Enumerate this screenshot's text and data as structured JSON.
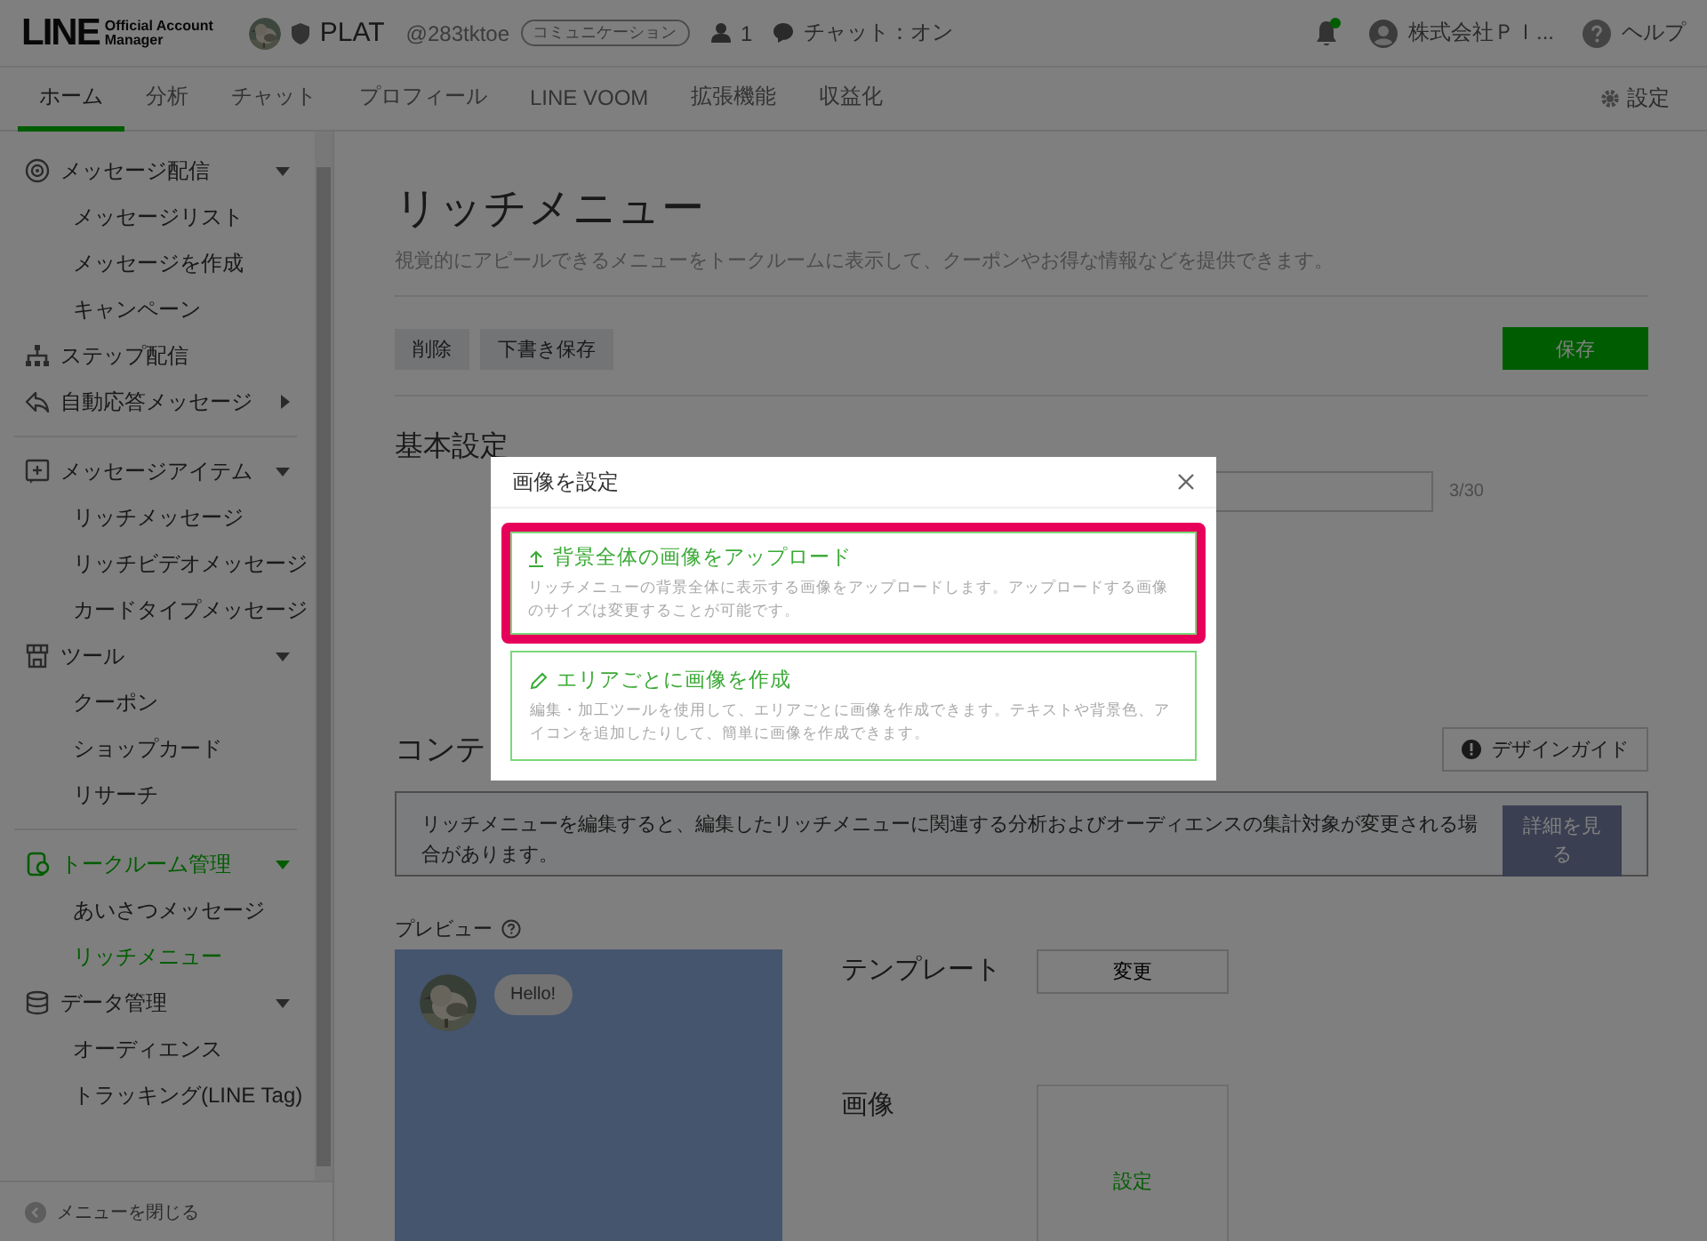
{
  "header": {
    "logo": {
      "word": "LINE",
      "tagline_1": "Official Account",
      "tagline_2": "Manager"
    },
    "account": {
      "name": "PLAT",
      "handle": "@283tktoe",
      "plan": "コミュニケーション",
      "members": "1",
      "chat": "チャット：オン"
    },
    "notifications": {
      "unread": true
    },
    "user": "株式会社ＰＩ...",
    "help": "ヘルプ"
  },
  "tabs": [
    {
      "label": "ホーム",
      "selected": true
    },
    {
      "label": "分析",
      "selected": false
    },
    {
      "label": "チャット",
      "selected": false
    },
    {
      "label": "プロフィール",
      "selected": false
    },
    {
      "label": "LINE VOOM",
      "selected": false
    },
    {
      "label": "拡張機能",
      "selected": false
    },
    {
      "label": "収益化",
      "selected": false
    }
  ],
  "settings": "設定",
  "sidebar": {
    "groups": [
      {
        "items": [
          {
            "label": "メッセージ配信",
            "selected": false,
            "expanded": true,
            "children": [
              {
                "label": "メッセージリスト",
                "selected": false
              },
              {
                "label": "メッセージを作成",
                "selected": false
              },
              {
                "label": "キャンペーン",
                "selected": false
              }
            ]
          },
          {
            "label": "ステップ配信",
            "selected": false
          },
          {
            "label": "自動応答メッセージ",
            "selected": false,
            "expanded": false
          }
        ]
      },
      {
        "items": [
          {
            "label": "メッセージアイテム",
            "selected": false,
            "expanded": true,
            "children": [
              {
                "label": "リッチメッセージ",
                "selected": false
              },
              {
                "label": "リッチビデオメッセージ",
                "selected": false
              },
              {
                "label": "カードタイプメッセージ",
                "selected": false
              }
            ]
          },
          {
            "label": "ツール",
            "selected": false,
            "expanded": true,
            "children": [
              {
                "label": "クーポン",
                "selected": false
              },
              {
                "label": "ショップカード",
                "selected": false
              },
              {
                "label": "リサーチ",
                "selected": false
              }
            ]
          }
        ]
      },
      {
        "items": [
          {
            "label": "トークルーム管理",
            "selected": true,
            "expanded": true,
            "children": [
              {
                "label": "あいさつメッセージ",
                "selected": false
              },
              {
                "label": "リッチメニュー",
                "selected": true
              }
            ]
          },
          {
            "label": "データ管理",
            "selected": false,
            "expanded": true,
            "children": [
              {
                "label": "オーディエンス",
                "selected": false
              },
              {
                "label": "トラッキング(LINE Tag)",
                "selected": false
              }
            ]
          }
        ]
      }
    ],
    "close": "メニューを閉じる"
  },
  "main": {
    "title": "リッチメニュー",
    "description": "視覚的にアピールできるメニューをトークルームに表示して、クーポンやお得な情報などを提供できます。",
    "actions": [
      {
        "label": "削除",
        "kind": "secondary"
      },
      {
        "label": "下書き保存",
        "kind": "secondary"
      },
      {
        "label": "保存",
        "kind": "primary"
      }
    ],
    "basic": {
      "heading": "基本設定",
      "counter": "3/30"
    },
    "content": {
      "heading": "コンテ",
      "guide": "デザインガイド",
      "notice": "リッチメニューを編集すると、編集したリッチメニューに関連する分析およびオーディエンスの集計対象が変更される場合があります。",
      "notice_button": "詳細を見る",
      "preview_label": "プレビュー",
      "bubble": "Hello!",
      "template_label": "テンプレート",
      "template_button": "変更",
      "image_label": "画像",
      "image_button": "設定"
    }
  },
  "dialog": {
    "title": "画像を設定",
    "options": [
      {
        "title": "背景全体の画像をアップロード",
        "description": "リッチメニューの背景全体に表示する画像をアップロードします。アップロードする画像のサイズは変更することが可能です。",
        "highlighted": true
      },
      {
        "title": "エリアごとに画像を作成",
        "description": "編集・加工ツールを使用して、エリアごとに画像を作成できます。テキストや背景色、アイコンを追加したりして、簡単に画像を作成できます。",
        "highlighted": false
      }
    ]
  }
}
